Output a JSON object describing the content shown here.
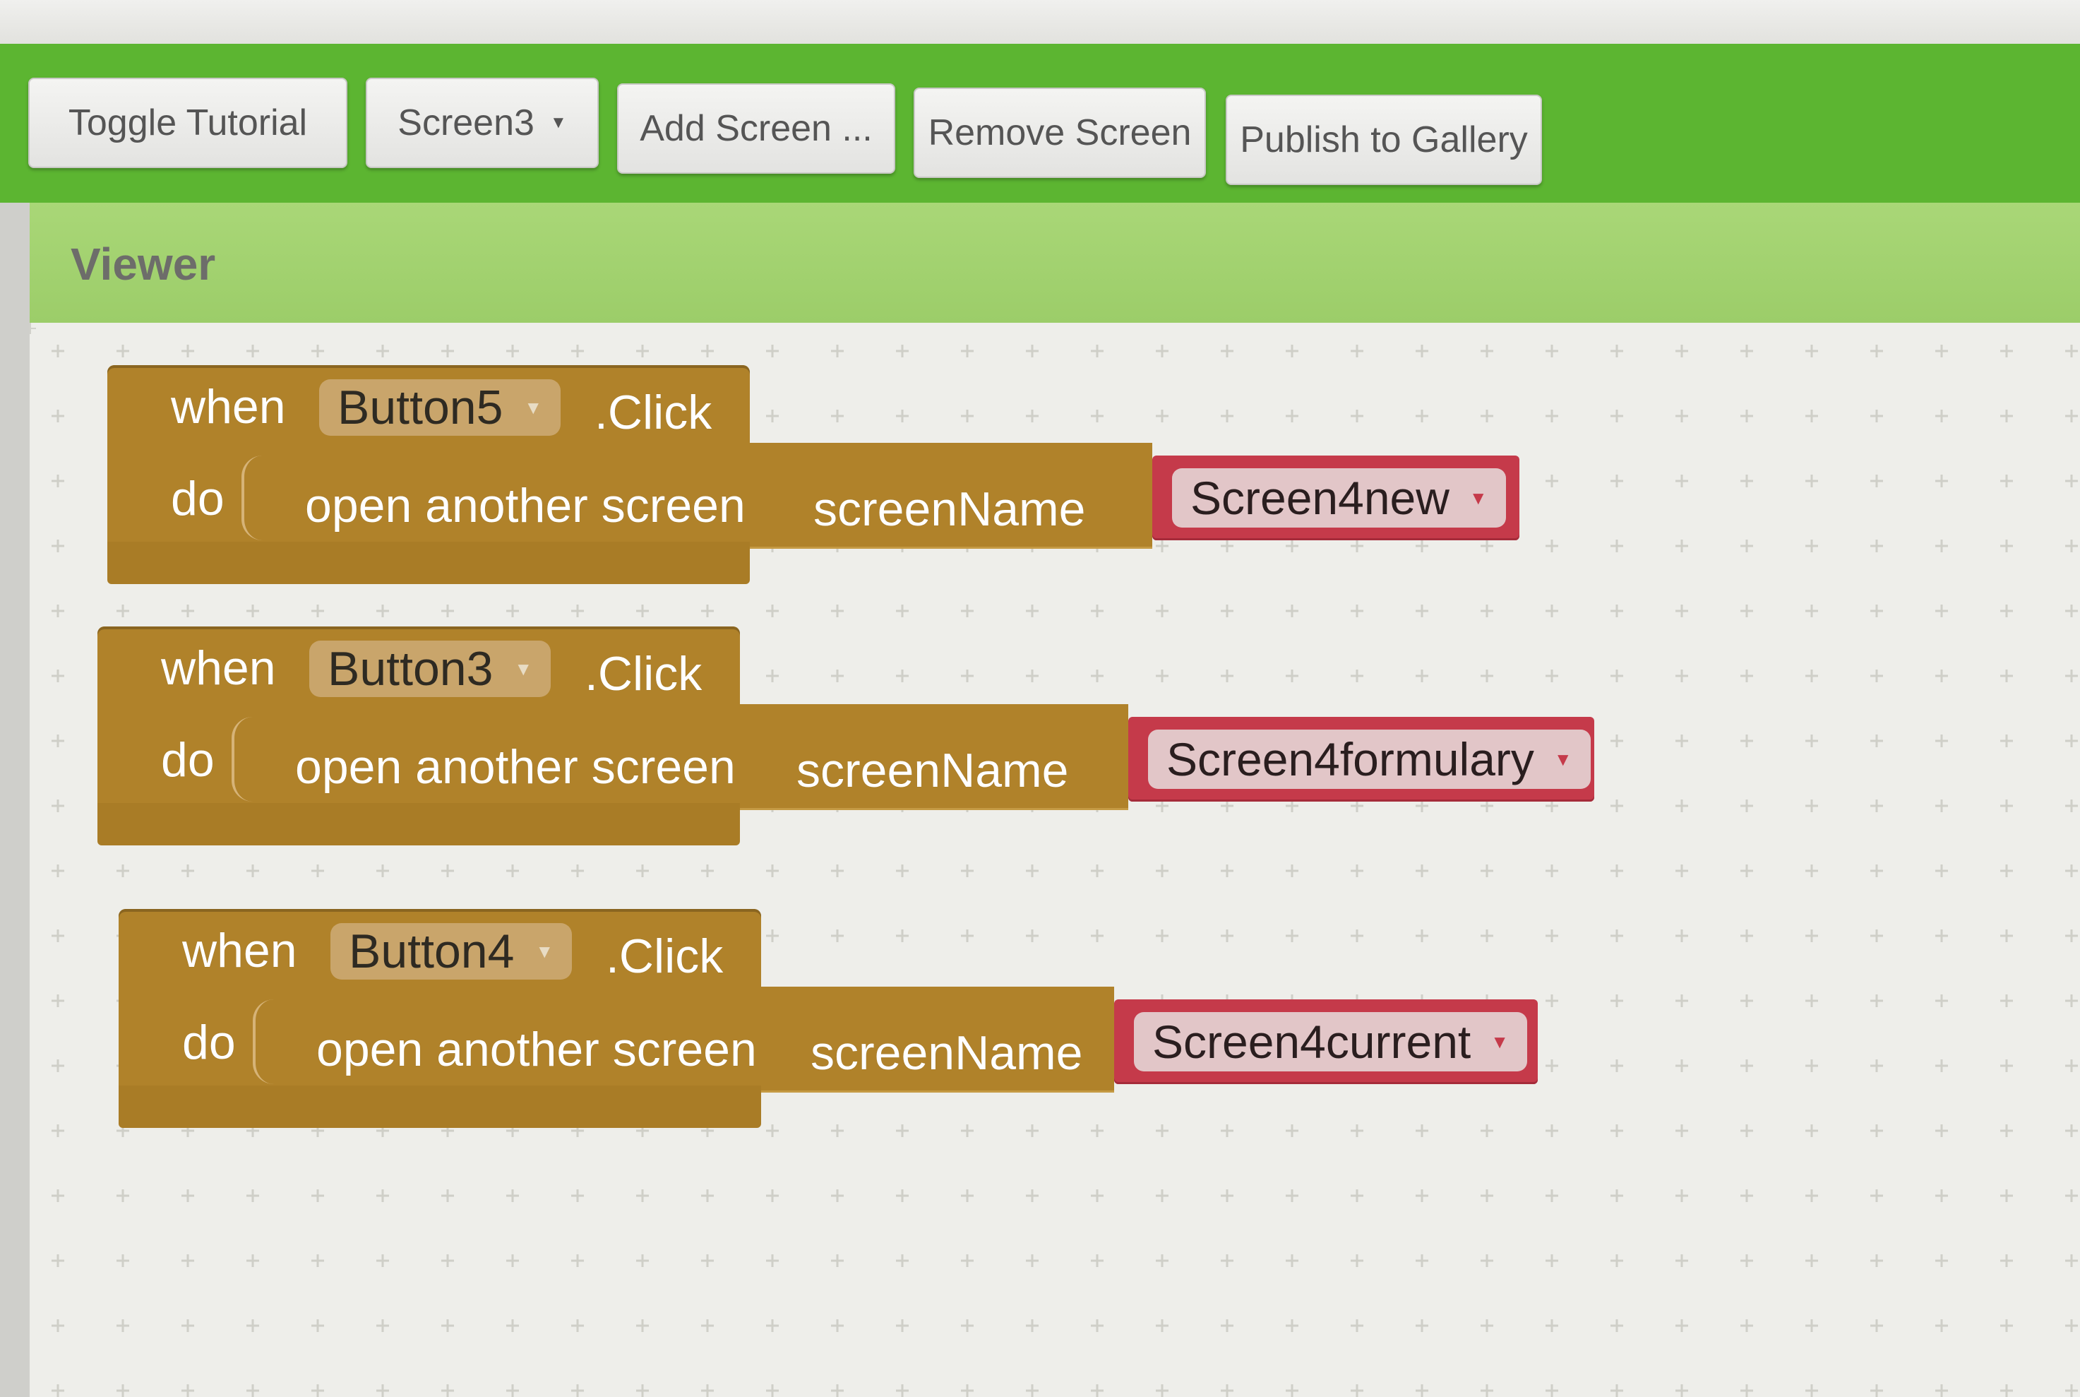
{
  "toolbar": {
    "toggle_tutorial": "Toggle Tutorial",
    "screen_select": "Screen3",
    "add_screen": "Add Screen ...",
    "remove_screen": "Remove Screen",
    "publish": "Publish to Gallery"
  },
  "viewer": {
    "title": "Viewer"
  },
  "blocks": [
    {
      "when": "when",
      "component": "Button5",
      "event": ".Click",
      "do": "do",
      "action": "open another screen",
      "param": "screenName",
      "screen": "Screen4new"
    },
    {
      "when": "when",
      "component": "Button3",
      "event": ".Click",
      "do": "do",
      "action": "open another screen",
      "param": "screenName",
      "screen": "Screen4formulary"
    },
    {
      "when": "when",
      "component": "Button4",
      "event": ".Click",
      "do": "do",
      "action": "open another screen",
      "param": "screenName",
      "screen": "Screen4current"
    }
  ],
  "colors": {
    "toolbar_green": "#5cb531",
    "viewer_header": "#a9d777",
    "event_block": "#b0822a",
    "screen_block": "#c53a4a"
  },
  "icons": {
    "dropdown": "caret-down-icon"
  }
}
